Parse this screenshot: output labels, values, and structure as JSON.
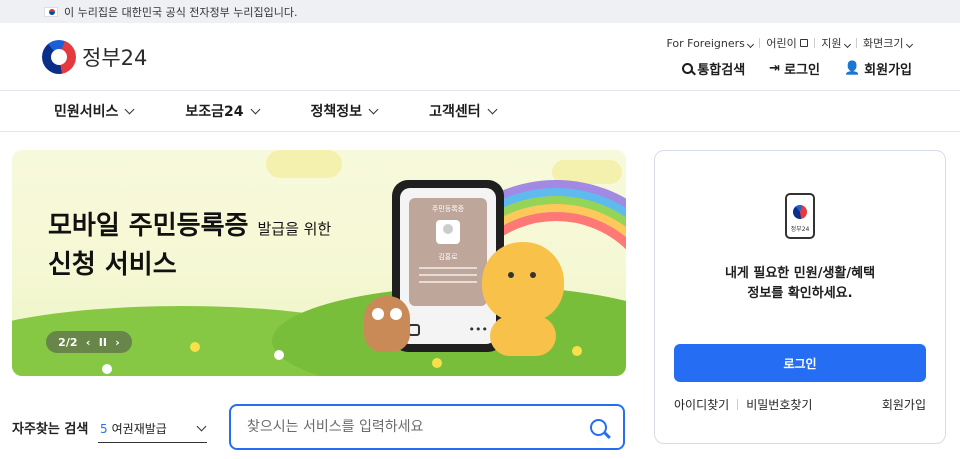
{
  "gov_banner": {
    "text": "이 누리집은 대한민국 공식 전자정부 누리집입니다."
  },
  "logo": {
    "text": "정부24"
  },
  "utility": {
    "top": [
      "For Foreigners",
      "어린이",
      "지원",
      "화면크기"
    ],
    "search": "통합검색",
    "login": "로그인",
    "signup": "회원가입"
  },
  "nav": {
    "items": [
      "민원서비스",
      "보조금24",
      "정책정보",
      "고객센터"
    ]
  },
  "banner": {
    "headline_line1": "모바일 주민등록증",
    "headline_sub": "발급을 위한",
    "headline_line2": "신청 서비스",
    "card_title": "주민등록증",
    "card_name": "김홍로",
    "pager": "2/2"
  },
  "frequent": {
    "label": "자주찾는 검색",
    "num": "5",
    "value": "여권재발급"
  },
  "search": {
    "placeholder": "찾으시는 서비스를 입력하세요"
  },
  "login_panel": {
    "icon_text": "정부24",
    "message_line1": "내게 필요한 민원/생활/혜택",
    "message_line2": "정보를 확인하세요.",
    "button": "로그인",
    "find_id": "아이디찾기",
    "find_pw": "비밀번호찾기",
    "signup": "회원가입"
  },
  "colors": {
    "primary": "#256ef4",
    "banner_bg": "#f5f8d3"
  }
}
